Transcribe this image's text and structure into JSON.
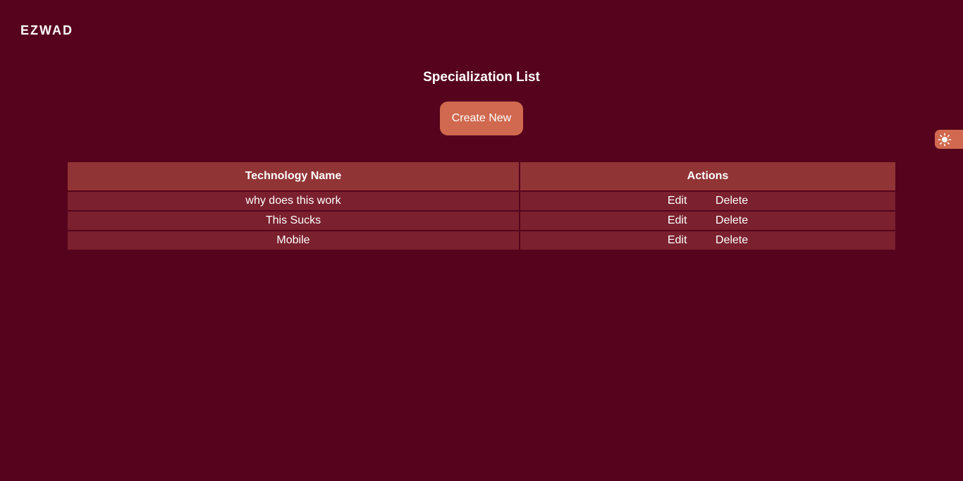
{
  "header": {
    "brand": "EZWAD"
  },
  "main": {
    "title": "Specialization List",
    "create_button": "Create New"
  },
  "theme_toggle": {
    "icon": "sun-icon",
    "color": "#d0694f"
  },
  "table": {
    "columns": [
      "Technology Name",
      "Actions"
    ],
    "rows": [
      {
        "name": "why does this work",
        "edit": "Edit",
        "delete": "Delete"
      },
      {
        "name": "This Sucks",
        "edit": "Edit",
        "delete": "Delete"
      },
      {
        "name": "Mobile",
        "edit": "Edit",
        "delete": "Delete"
      }
    ]
  },
  "colors": {
    "background": "#56041d",
    "header_row": "#913436",
    "body_row": "#7b202e",
    "accent": "#d0694f"
  }
}
